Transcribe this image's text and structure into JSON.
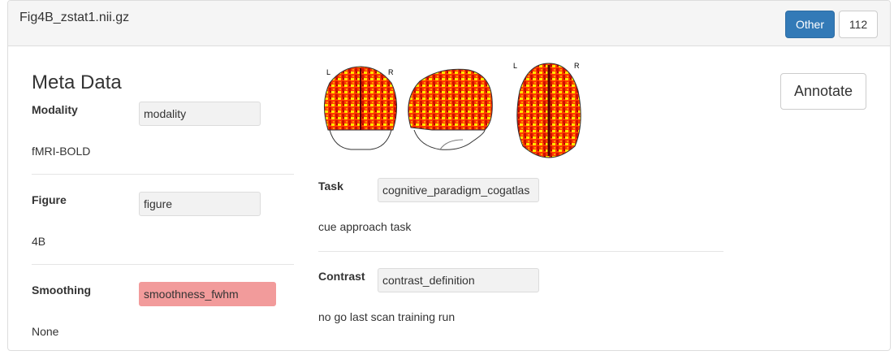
{
  "panel": {
    "title": "Fig4B_zstat1.nii.gz",
    "category_button": "Other",
    "count_button": "112"
  },
  "meta": {
    "title": "Meta Data",
    "fields": [
      {
        "label": "Modality",
        "input": "modality",
        "value": "fMRI-BOLD"
      },
      {
        "label": "Figure",
        "input": "figure",
        "value": "4B"
      },
      {
        "label": "Smoothing",
        "input": "smoothness_fwhm",
        "value": "None"
      }
    ]
  },
  "task": {
    "label": "Task",
    "input": "cognitive_paradigm_cogatlas",
    "value": "cue approach task"
  },
  "contrast": {
    "label": "Contrast",
    "input": "contrast_definition",
    "value": "no go last scan training run"
  },
  "brain": {
    "left_label": "L",
    "right_label": "R",
    "left_label_axial": "L",
    "right_label_axial": "R"
  },
  "annotate_button": "Annotate",
  "colors": {
    "primary": "#337ab7",
    "error_field": "#f29b9b",
    "heatmap_high": "#ff2000",
    "heatmap_low": "#ffe600"
  }
}
